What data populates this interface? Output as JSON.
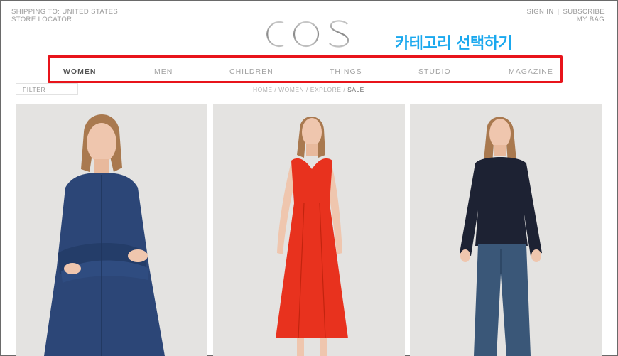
{
  "header": {
    "shipping": "SHIPPING TO: UNITED STATES",
    "store_locator": "STORE LOCATOR",
    "sign_in": "SIGN IN",
    "separator": "|",
    "subscribe": "SUBSCRIBE",
    "my_bag": "MY BAG",
    "logo_text": "COS"
  },
  "annotation": {
    "text": "카테고리 선택하기",
    "color": "#1aa8ee",
    "box_color": "#e8141b"
  },
  "nav": {
    "items": [
      {
        "label": "WOMEN",
        "active": true
      },
      {
        "label": "MEN",
        "active": false
      },
      {
        "label": "CHILDREN",
        "active": false
      },
      {
        "label": "THINGS",
        "active": false
      },
      {
        "label": "STUDIO",
        "active": false
      },
      {
        "label": "MAGAZINE",
        "active": false
      }
    ]
  },
  "filter": {
    "label": "FILTER"
  },
  "breadcrumb": {
    "items": [
      "HOME",
      "WOMEN",
      "EXPLORE",
      "SALE"
    ],
    "separator": "/"
  },
  "products": [
    {
      "description_icon": "navy-shirt-dress-model",
      "garment_color": "#2c4677"
    },
    {
      "description_icon": "red-sleeveless-dress-model",
      "garment_color": "#e8321e"
    },
    {
      "description_icon": "navy-sweater-jeans-model",
      "garment_color": "#1d2233"
    }
  ]
}
